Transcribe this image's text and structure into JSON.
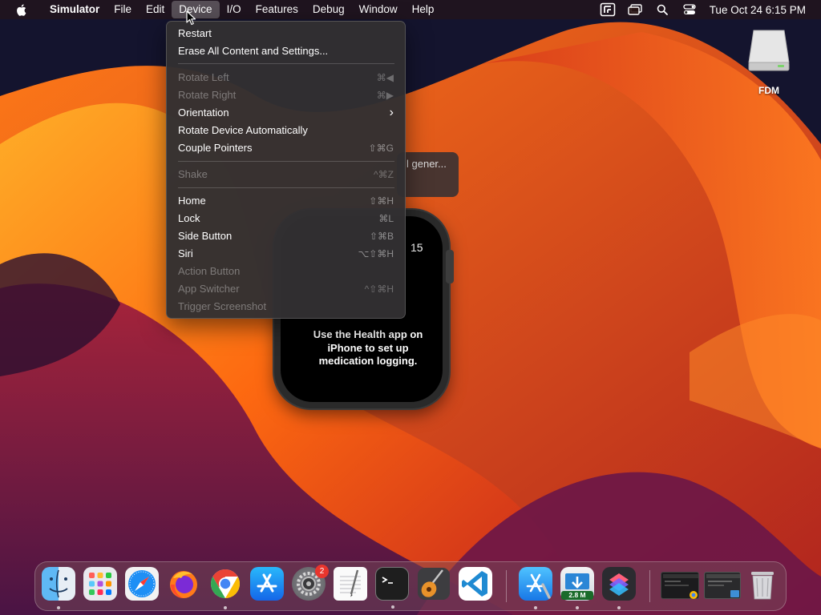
{
  "menubar": {
    "apple_icon": "apple-icon",
    "app_name": "Simulator",
    "items": [
      "File",
      "Edit",
      "Device",
      "I/O",
      "Features",
      "Debug",
      "Window",
      "Help"
    ],
    "active_item": "Device",
    "status_icons": [
      "screen-record-icon",
      "screen-mirroring-icon",
      "spotlight-search-icon",
      "control-center-icon"
    ],
    "clock": "Tue Oct 24  6:15 PM"
  },
  "desktop": {
    "drive_label": "FDM",
    "toast_text": "l gener..."
  },
  "watch": {
    "time_partial": "15",
    "message": "Use the Health app on iPhone to set up medication logging."
  },
  "device_menu": {
    "items": [
      {
        "label": "Restart",
        "shortcut": "",
        "enabled": true
      },
      {
        "label": "Erase All Content and Settings...",
        "shortcut": "",
        "enabled": true
      },
      {
        "label": "Rotate Left",
        "shortcut": "⌘◀",
        "enabled": false
      },
      {
        "label": "Rotate Right",
        "shortcut": "⌘▶",
        "enabled": false
      },
      {
        "label": "Orientation",
        "shortcut": "›",
        "enabled": true
      },
      {
        "label": "Rotate Device Automatically",
        "shortcut": "",
        "enabled": true
      },
      {
        "label": "Couple Pointers",
        "shortcut": "⇧⌘G",
        "enabled": true
      },
      {
        "label": "Shake",
        "shortcut": "^⌘Z",
        "enabled": false
      },
      {
        "label": "Home",
        "shortcut": "⇧⌘H",
        "enabled": true
      },
      {
        "label": "Lock",
        "shortcut": "⌘L",
        "enabled": true
      },
      {
        "label": "Side Button",
        "shortcut": "⇧⌘B",
        "enabled": true
      },
      {
        "label": "Siri",
        "shortcut": "⌥⇧⌘H",
        "enabled": true
      },
      {
        "label": "Action Button",
        "shortcut": "",
        "enabled": false
      },
      {
        "label": "App Switcher",
        "shortcut": "^⇧⌘H",
        "enabled": false
      },
      {
        "label": "Trigger Screenshot",
        "shortcut": "",
        "enabled": false
      }
    ]
  },
  "dock": {
    "apps": [
      {
        "name": "finder-icon",
        "running": true
      },
      {
        "name": "launchpad-icon",
        "running": false
      },
      {
        "name": "safari-icon",
        "running": false
      },
      {
        "name": "firefox-icon",
        "running": false
      },
      {
        "name": "chrome-icon",
        "running": true
      },
      {
        "name": "app-store-icon",
        "running": false
      },
      {
        "name": "system-settings-icon",
        "running": false,
        "badge": "2"
      },
      {
        "name": "textedit-icon",
        "running": false
      },
      {
        "name": "terminal-icon",
        "running": true
      },
      {
        "name": "garageband-icon",
        "running": false
      },
      {
        "name": "vscode-icon",
        "running": false
      },
      {
        "name": "xcode-icon",
        "running": true
      },
      {
        "name": "downloader-icon",
        "running": true,
        "label": "2.8 M"
      },
      {
        "name": "shortcuts-icon",
        "running": true
      },
      {
        "name": "minimized-window-1",
        "running": false
      },
      {
        "name": "minimized-window-2",
        "running": false
      },
      {
        "name": "trash-icon",
        "running": false
      }
    ]
  },
  "colors": {
    "menu_bg": "#323032",
    "badge_red": "#e8352d"
  }
}
